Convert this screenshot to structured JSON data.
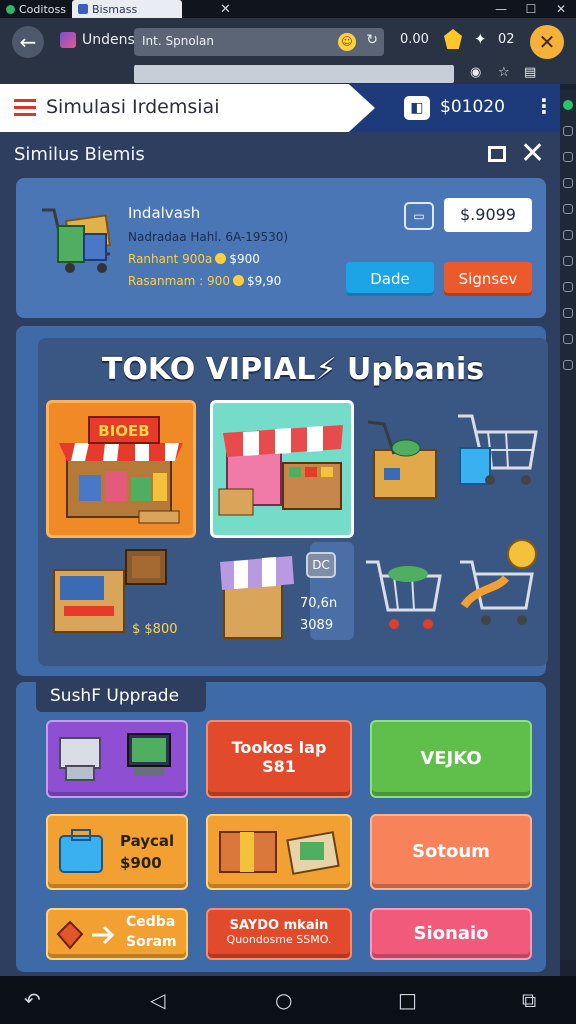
{
  "browser": {
    "tabs": [
      {
        "label": "Coditoss"
      },
      {
        "label": "Bismass"
      }
    ],
    "site_name": "Undens",
    "url": "Int. Spnolan",
    "zoom": "0.00",
    "count": "02"
  },
  "app": {
    "title": "Simulasi Irdemsiai",
    "cash": "$01020"
  },
  "panel": {
    "title": "Similus Biemis",
    "business": {
      "name": "Indalvash",
      "subtitle": "Nadradaa Hahl. 6A-19530)",
      "row1_label": "Ranhant 900a",
      "row1_value": "$900",
      "row2_label": "Rasanmam : 900",
      "row2_value": "$9,90",
      "price": "$.9099",
      "wallet_icon": "▭",
      "btn_blue": "Dade",
      "btn_red": "Signsev"
    },
    "shop": {
      "title": "TOKO VIPIAL⚡ Upbanis",
      "sign": "BIOEB",
      "badge": "DC",
      "stat_a": "70,6n",
      "stat_b": "3089",
      "price": "$ $800"
    },
    "upgrade": {
      "tab_label": "SushF Upprade",
      "buttons": [
        {
          "line1": "Tookos lap",
          "line2": "S81"
        },
        {
          "line1": "VEJKO"
        },
        {
          "line1": "Paycal",
          "line2": "$900"
        },
        {
          "line1": "Sotoum"
        },
        {
          "line1": "Cedba",
          "line2": "Soram"
        },
        {
          "line1": "SAYDO mkain",
          "line2": "Quondosme SSMO."
        },
        {
          "line1": "Sionaio"
        }
      ]
    }
  },
  "colors": {
    "header_blue": "#1d3a7a",
    "card_blue": "#4a76b6",
    "panel_bg": "#2d3e5f",
    "accent_orange": "#f3a033",
    "accent_red": "#e24a2c",
    "accent_green": "#5fbf4a"
  }
}
